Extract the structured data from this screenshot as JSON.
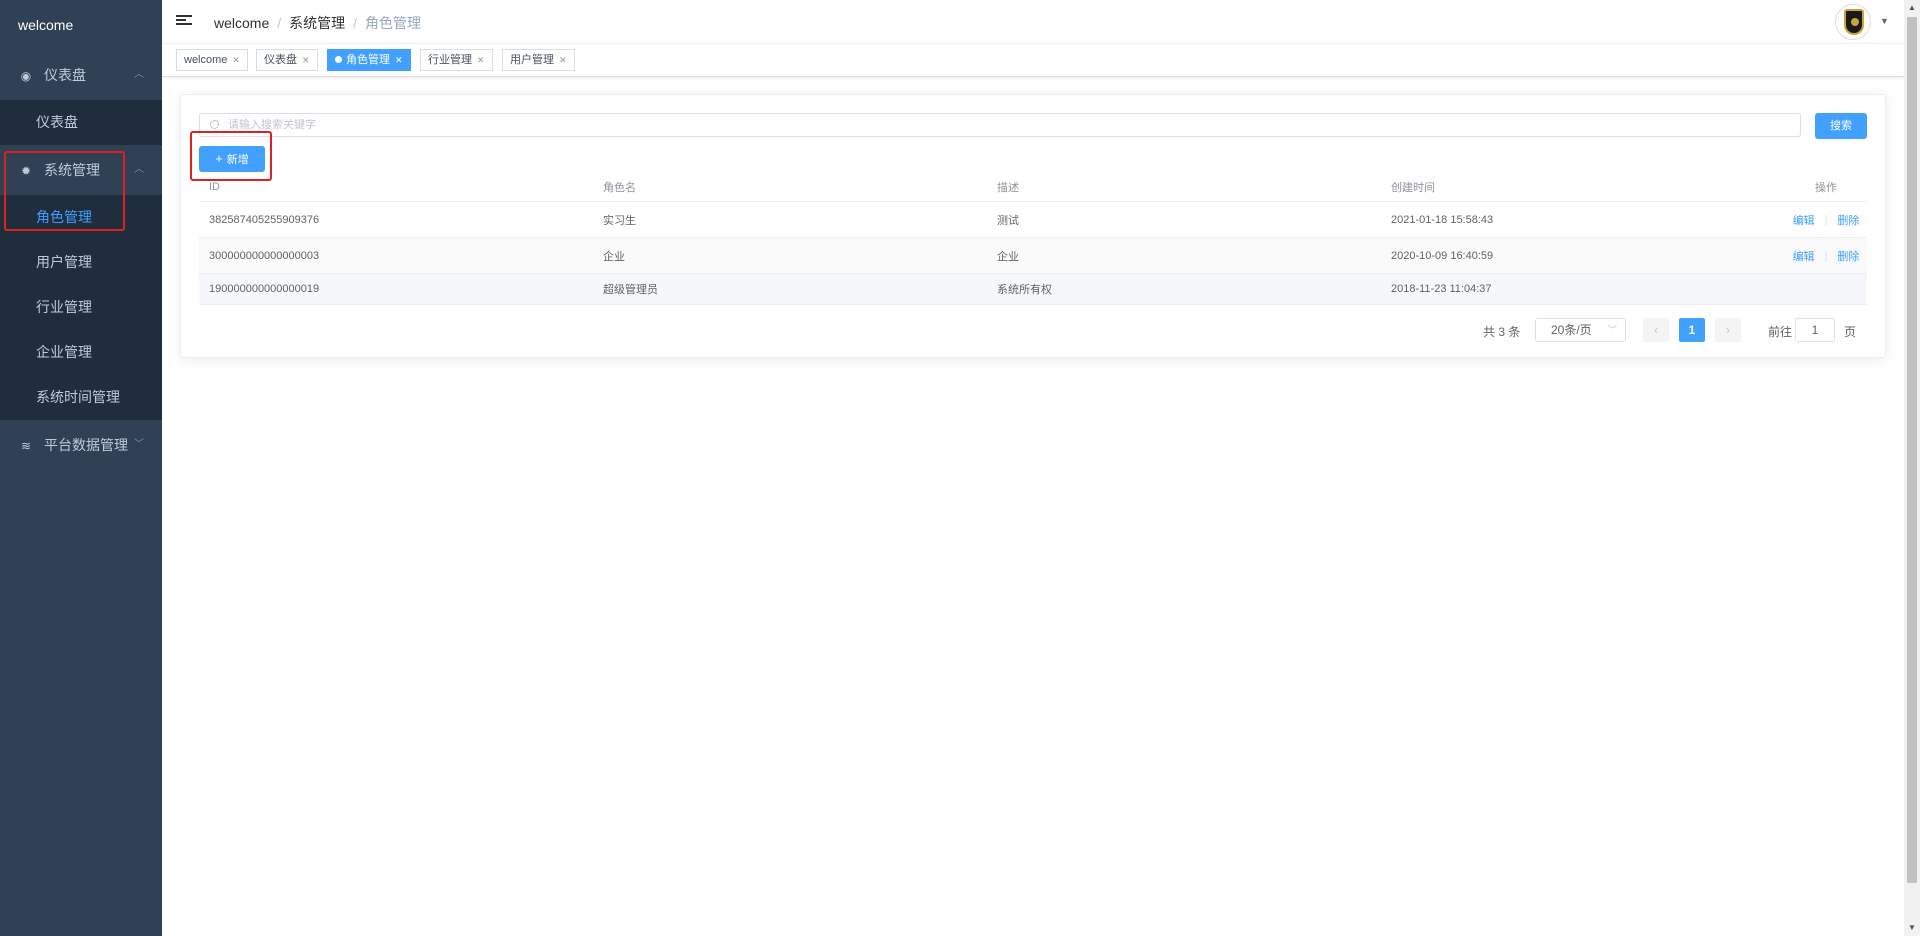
{
  "sidebar": {
    "logo": "welcome",
    "groups": [
      {
        "label": "仪表盘",
        "icon": "dashboard-icon",
        "expanded": true,
        "items": [
          "仪表盘"
        ]
      },
      {
        "label": "系统管理",
        "icon": "gear-icon",
        "expanded": true,
        "items": [
          "角色管理",
          "用户管理",
          "行业管理",
          "企业管理",
          "系统时间管理"
        ],
        "active_item": "角色管理"
      },
      {
        "label": "平台数据管理",
        "icon": "layers-icon",
        "expanded": false,
        "items": []
      }
    ]
  },
  "navbar": {
    "breadcrumb": [
      "welcome",
      "系统管理",
      "角色管理"
    ],
    "separator": "/"
  },
  "tags": [
    {
      "label": "welcome",
      "active": false
    },
    {
      "label": "仪表盘",
      "active": false
    },
    {
      "label": "角色管理",
      "active": true
    },
    {
      "label": "行业管理",
      "active": false
    },
    {
      "label": "用户管理",
      "active": false
    }
  ],
  "search": {
    "placeholder": "请输入搜索关键字",
    "button": "搜索"
  },
  "add_button": "新增",
  "table": {
    "columns": [
      "ID",
      "角色名",
      "描述",
      "创建时间",
      "操作"
    ],
    "rows": [
      {
        "id": "382587405255909376",
        "name": "实习生",
        "desc": "测试",
        "created": "2021-01-18 15:58:43",
        "actions": [
          "编辑",
          "删除"
        ]
      },
      {
        "id": "300000000000000003",
        "name": "企业",
        "desc": "企业",
        "created": "2020-10-09 16:40:59",
        "actions": [
          "编辑",
          "删除"
        ]
      },
      {
        "id": "190000000000000019",
        "name": "超级管理员",
        "desc": "系统所有权",
        "created": "2018-11-23 11:04:37",
        "actions": []
      }
    ]
  },
  "pagination": {
    "total": "共 3 条",
    "page_size": "20条/页",
    "current_page": "1",
    "goto_label": "前往",
    "goto_value": "1",
    "page_unit": "页"
  },
  "colors": {
    "sidebar_bg": "#304156",
    "accent": "#42a0ff",
    "highlight_box": "#e02020"
  }
}
